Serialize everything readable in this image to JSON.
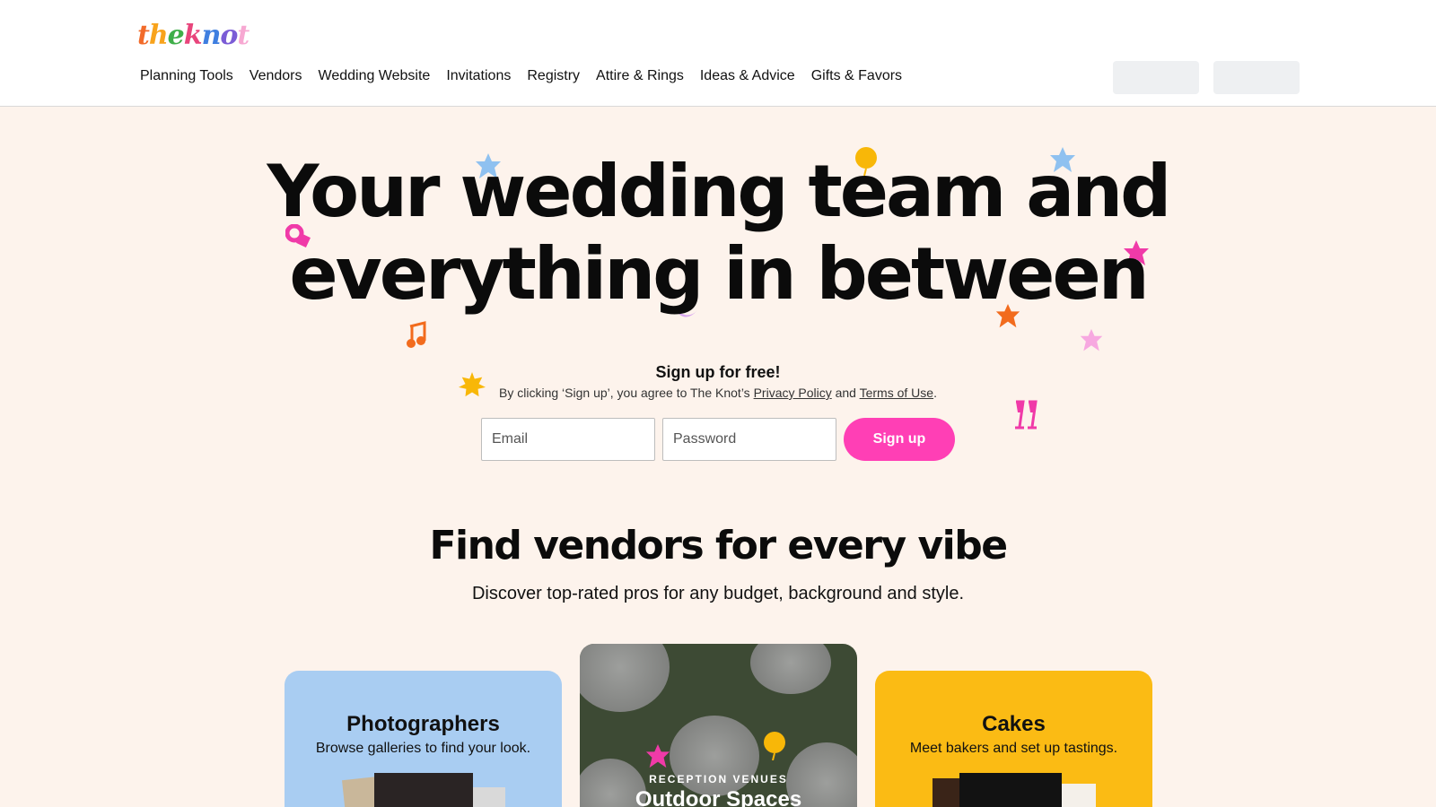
{
  "header": {
    "logo_letters": [
      "t",
      "h",
      "e",
      "k",
      "n",
      "o",
      "t"
    ],
    "logo_colors": [
      "#f26b2a",
      "#f8a31c",
      "#3fae49",
      "#e8457c",
      "#3f7fe0",
      "#7b5cd6",
      "#f7a8d2"
    ],
    "nav": [
      "Planning Tools",
      "Vendors",
      "Wedding Website",
      "Invitations",
      "Registry",
      "Attire & Rings",
      "Ideas & Advice",
      "Gifts & Favors"
    ]
  },
  "hero": {
    "title_line1": "Your wedding team and",
    "title_line2": "everything in between"
  },
  "signup": {
    "title": "Sign up for free!",
    "terms_prefix": "By clicking ‘Sign up’, you agree to The Knot’s ",
    "privacy_link": "Privacy Policy",
    "terms_mid": " and ",
    "terms_link": "Terms of Use",
    "terms_suffix": ".",
    "email_placeholder": "Email",
    "password_placeholder": "Password",
    "button_label": "Sign up"
  },
  "vendors": {
    "title": "Find vendors for every vibe",
    "subtitle": "Discover top-rated pros for any budget, background and style.",
    "cards": [
      {
        "title": "Photographers",
        "subtitle": "Browse galleries to find your look."
      },
      {
        "label": "RECEPTION VENUES",
        "title": "Outdoor Spaces"
      },
      {
        "title": "Cakes",
        "subtitle": "Meet bakers and set up tastings."
      }
    ]
  },
  "colors": {
    "accent": "#ff3fb5",
    "page_bg": "#fdf3ec",
    "photo_card": "#a9cdf2",
    "cakes_card": "#fbbb14"
  }
}
